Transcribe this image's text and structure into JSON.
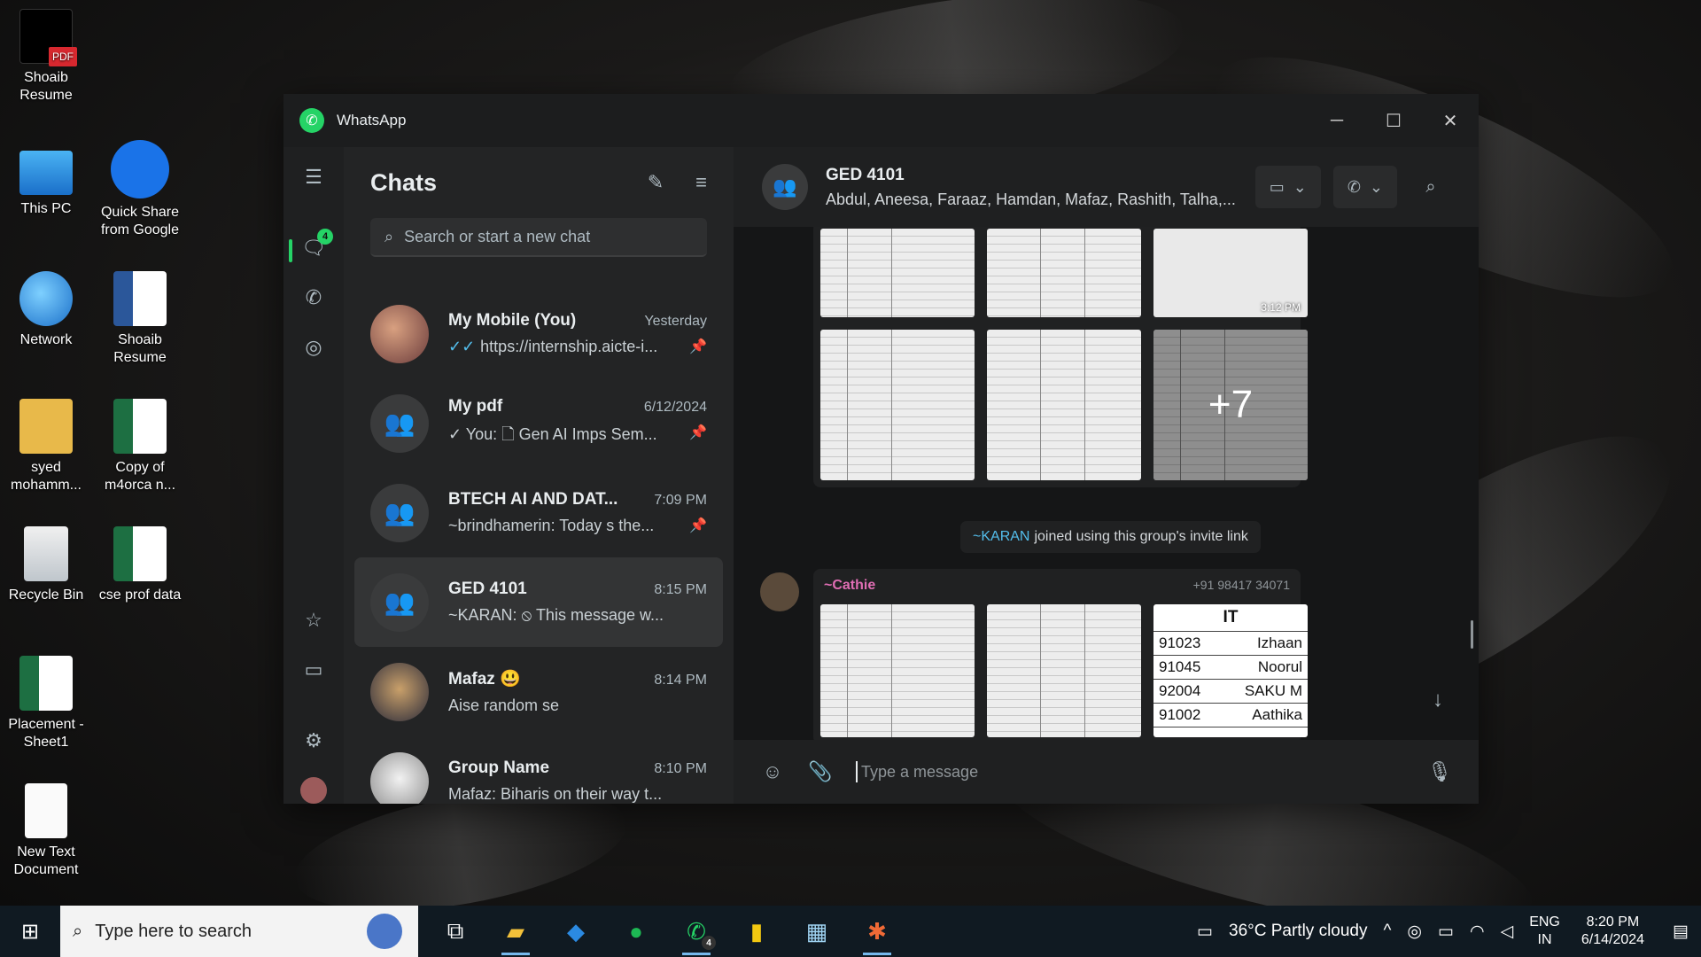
{
  "desktop": {
    "icons": [
      {
        "label": "Shoaib\nResume"
      },
      {
        "label": "This PC"
      },
      {
        "label": "Quick Share from Google"
      },
      {
        "label": "Network"
      },
      {
        "label": "Shoaib Resume"
      },
      {
        "label": "syed mohamm..."
      },
      {
        "label": "Copy of m4orca n..."
      },
      {
        "label": "Recycle Bin"
      },
      {
        "label": "cse prof data"
      },
      {
        "label": "Placement - Sheet1"
      },
      {
        "label": "New Text Document"
      }
    ]
  },
  "window": {
    "app_title": "WhatsApp",
    "minimize": "─",
    "maximize": "☐",
    "close": "✕"
  },
  "rail": {
    "chats_badge": "4"
  },
  "chatlist": {
    "title": "Chats",
    "search_placeholder": "Search or start a new chat",
    "chats": [
      {
        "name": "My Mobile (You)",
        "time": "Yesterday",
        "preview": "https://internship.aicte-i...",
        "tick": "✓✓"
      },
      {
        "name": "My pdf",
        "time": "6/12/2024",
        "preview": "✓ You: 🗋 Gen AI Imps Sem..."
      },
      {
        "name": "BTECH AI AND DAT...",
        "time": "7:09 PM",
        "preview": "~brindhamerin: Today s the..."
      },
      {
        "name": "GED 4101",
        "time": "8:15 PM",
        "preview": "~KARAN: ⦸ This message w..."
      },
      {
        "name": "Mafaz 😃",
        "time": "8:14 PM",
        "preview": "Aise random se"
      },
      {
        "name": "Group Name",
        "time": "8:10 PM",
        "preview": "Mafaz: Biharis on their way t..."
      }
    ]
  },
  "conversation": {
    "group_name": "GED 4101",
    "members": "Abdul, Aneesa, Faraaz, Hamdan, Mafaz, Rashith, Talha,...",
    "first_album_time": "3:12 PM",
    "more_count": "+7",
    "system_who": "~KARAN",
    "system_text": "joined using this group's invite link",
    "sender_name": "~Cathie",
    "sender_phone": "+91 98417 34071",
    "it_sheet": {
      "header": "IT",
      "rows": [
        {
          "id": "91023",
          "name": "Izhaan"
        },
        {
          "id": "91045",
          "name": "Noorul"
        },
        {
          "id": "92004",
          "name": "SAKU M"
        },
        {
          "id": "91002",
          "name": "Aathika"
        }
      ]
    },
    "composer_placeholder": "Type a message"
  },
  "taskbar": {
    "search_placeholder": "Type here to search",
    "weather": "36°C  Partly cloudy",
    "lang_1": "ENG",
    "lang_2": "IN",
    "time": "8:20 PM",
    "date": "6/14/2024",
    "whatsapp_badge": "4"
  }
}
